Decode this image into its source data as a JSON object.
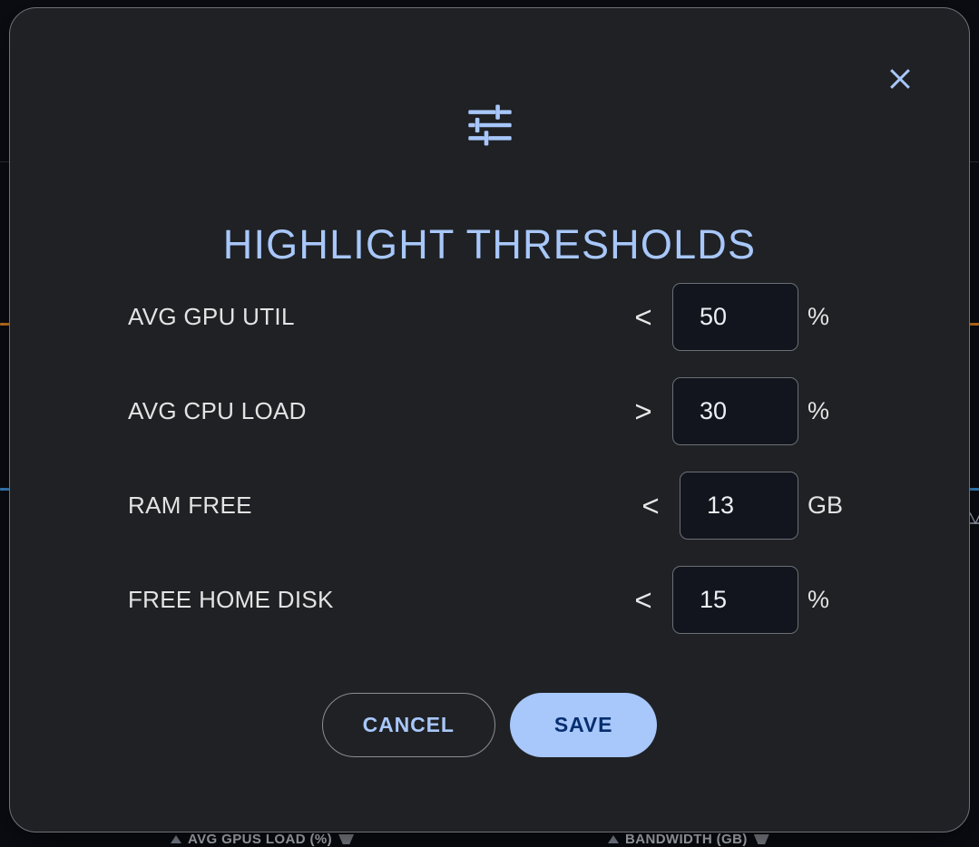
{
  "dialog": {
    "title": "HIGHLIGHT THRESHOLDS",
    "icon": "tune-sliders-icon",
    "close_icon": "close-icon",
    "accent_color": "#a8c7fa",
    "surface_color": "#1f2124",
    "label_color": "#e3e3e3",
    "input_bg_color": "#12151d",
    "save_text_color": "#062e6f"
  },
  "thresholds": [
    {
      "label": "AVG GPU UTIL",
      "operator": "<",
      "value": "50",
      "unit": "%"
    },
    {
      "label": "AVG CPU LOAD",
      "operator": ">",
      "value": "30",
      "unit": "%"
    },
    {
      "label": "RAM FREE",
      "operator": "<",
      "value": "13",
      "unit": "GB"
    },
    {
      "label": "FREE HOME DISK",
      "operator": "<",
      "value": "15",
      "unit": "%"
    }
  ],
  "actions": {
    "cancel_label": "CANCEL",
    "save_label": "SAVE"
  },
  "background": {
    "chart_labels": [
      {
        "text": "AVG GPUS LOAD (%)"
      },
      {
        "text": "BANDWIDTH (GB)"
      }
    ],
    "series_colors": [
      "#d97d20",
      "#3b8ed0"
    ]
  }
}
